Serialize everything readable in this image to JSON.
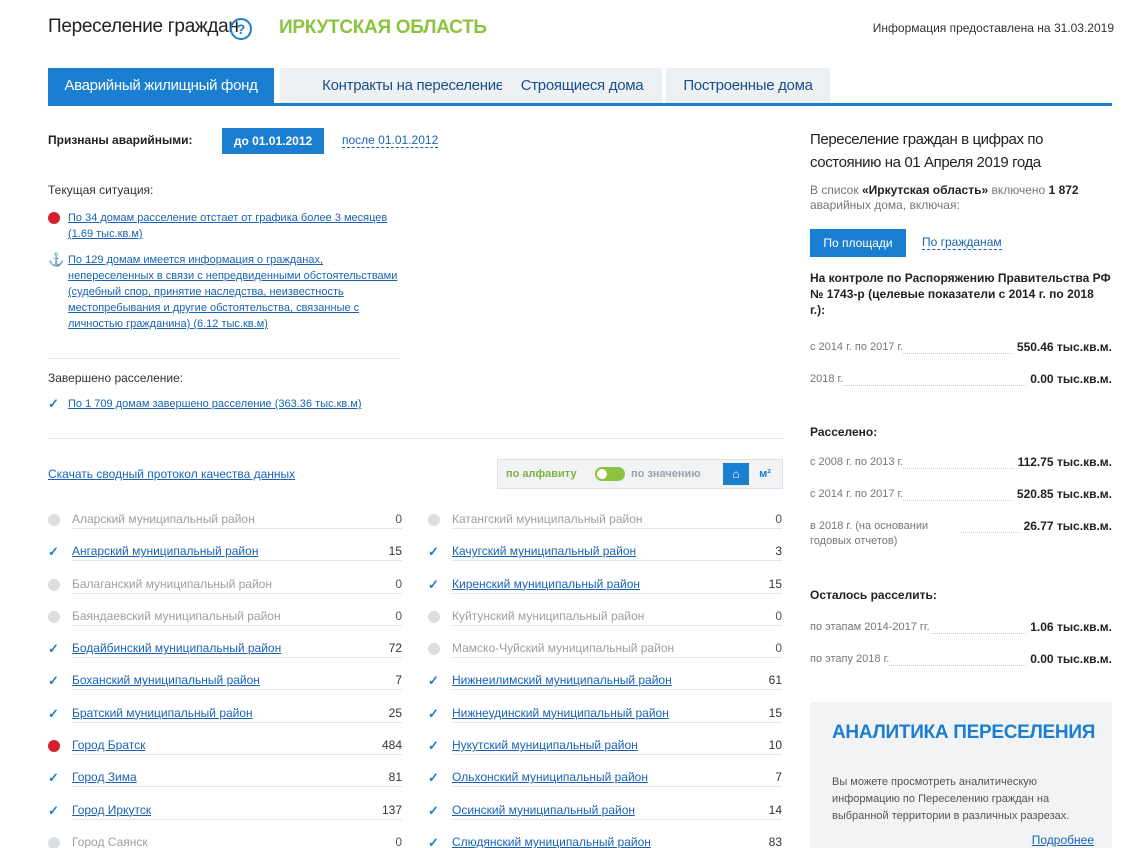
{
  "header": {
    "title": "Переселение граждан",
    "help_icon": "question-circle-icon",
    "region": "ИРКУТСКАЯ ОБЛАСТЬ",
    "info_date": "Информация предоставлена на 31.03.2019"
  },
  "tabs": [
    {
      "label": "Аварийный жилищный фонд",
      "active": true
    },
    {
      "label": "Контракты на переселение",
      "active": false
    },
    {
      "label": "Строящиеся дома",
      "active": false
    },
    {
      "label": "Построенные дома",
      "active": false
    }
  ],
  "recognized": {
    "label": "Признаны аварийными:",
    "before": "до 01.01.2012",
    "after": "после 01.01.2012"
  },
  "current": {
    "label": "Текущая ситуация:",
    "items": [
      {
        "icon": "red-dot-icon",
        "text": "По 34 домам расселение отстает от графика более 3 месяцев (1.69 тыс.кв.м)"
      },
      {
        "icon": "anchor-icon",
        "text": "По 129 домам имеется информация о гражданах, непереселенных в связи с непредвиденными обстоятельствами (судебный спор, принятие наследства, неизвестность местопребывания и другие обстоятельства, связанные с личностью гражданина) (6.12 тыс.кв.м)"
      }
    ]
  },
  "completed": {
    "label": "Завершено расселение:",
    "items": [
      {
        "icon": "check-icon",
        "text": "По 1 709 домам завершено расселение (363.36 тыс.кв.м)"
      }
    ]
  },
  "download_link": "Скачать сводный протокол качества данных",
  "sort": {
    "alpha": "по алфавиту",
    "value": "по значению",
    "home_icon": "home-icon",
    "m2": "м²"
  },
  "districts_left": [
    {
      "name": "Аларский муниципальный район",
      "value": "0",
      "status": "none"
    },
    {
      "name": "Ангарский муниципальный район",
      "value": "15",
      "status": "check"
    },
    {
      "name": "Балаганский муниципальный район",
      "value": "0",
      "status": "none"
    },
    {
      "name": "Баяндаевский муниципальный район",
      "value": "0",
      "status": "none"
    },
    {
      "name": "Бодайбинский муниципальный район",
      "value": "72",
      "status": "check"
    },
    {
      "name": "Боханский муниципальный район",
      "value": "7",
      "status": "check"
    },
    {
      "name": "Братский муниципальный район",
      "value": "25",
      "status": "check"
    },
    {
      "name": "Город Братск",
      "value": "484",
      "status": "red"
    },
    {
      "name": "Город Зима",
      "value": "81",
      "status": "check"
    },
    {
      "name": "Город Иркутск",
      "value": "137",
      "status": "check"
    },
    {
      "name": "Город Саянск",
      "value": "0",
      "status": "none"
    }
  ],
  "districts_right": [
    {
      "name": "Катангский муниципальный район",
      "value": "0",
      "status": "none"
    },
    {
      "name": "Качугский муниципальный район",
      "value": "3",
      "status": "check"
    },
    {
      "name": "Киренский муниципальный район",
      "value": "15",
      "status": "check"
    },
    {
      "name": "Куйтунский муниципальный район",
      "value": "0",
      "status": "none"
    },
    {
      "name": "Мамско-Чуйский муниципальный район",
      "value": "0",
      "status": "none"
    },
    {
      "name": "Нижнеилимский муниципальный район",
      "value": "61",
      "status": "check"
    },
    {
      "name": "Нижнеудинский муниципальный район",
      "value": "15",
      "status": "check"
    },
    {
      "name": "Нукутский муниципальный район",
      "value": "10",
      "status": "check"
    },
    {
      "name": "Ольхонский муниципальный район",
      "value": "7",
      "status": "check"
    },
    {
      "name": "Осинский муниципальный район",
      "value": "14",
      "status": "check"
    },
    {
      "name": "Слюдянский муниципальный район",
      "value": "83",
      "status": "check"
    }
  ],
  "stats": {
    "title": "Переселение граждан в цифрах по состоянию на 01 Апреля 2019 года",
    "intro_a": "В список ",
    "intro_region": "«Иркутская область»",
    "intro_b": " включено ",
    "intro_count": "1 872",
    "intro_c": " аварийных дома, включая:",
    "btn_area": "По площади",
    "link_citizens": "По гражданам",
    "control_title": "На контроле по Распоряжению Правительства РФ № 1743-р (целевые показатели с 2014 г. по 2018 г.):",
    "control_rows": [
      {
        "label": "с 2014 г. по 2017 г.",
        "value": "550.46 тыс.кв.м."
      },
      {
        "label": "2018 г.",
        "value": "0.00 тыс.кв.м."
      }
    ],
    "resettled_title": "Расселено:",
    "resettled_rows": [
      {
        "label": "с 2008 г. по 2013 г.",
        "value": "112.75 тыс.кв.м."
      },
      {
        "label": "с 2014 г. по 2017 г.",
        "value": "520.85 тыс.кв.м."
      },
      {
        "label": "в 2018 г. (на основании годовых отчетов)",
        "value": "26.77 тыс.кв.м."
      }
    ],
    "remain_title": "Осталось расселить:",
    "remain_rows": [
      {
        "label": "по этапам 2014-2017 гг.",
        "value": "1.06 тыс.кв.м."
      },
      {
        "label": "по этапу 2018 г.",
        "value": "0.00 тыс.кв.м."
      }
    ]
  },
  "analytics": {
    "title": "АНАЛИТИКА ПЕРЕСЕЛЕНИЯ",
    "text": "Вы можете просмотреть аналитическую информацию по Переселению граждан на выбранной территории в различных разрезах.",
    "more": "Подробнее"
  }
}
